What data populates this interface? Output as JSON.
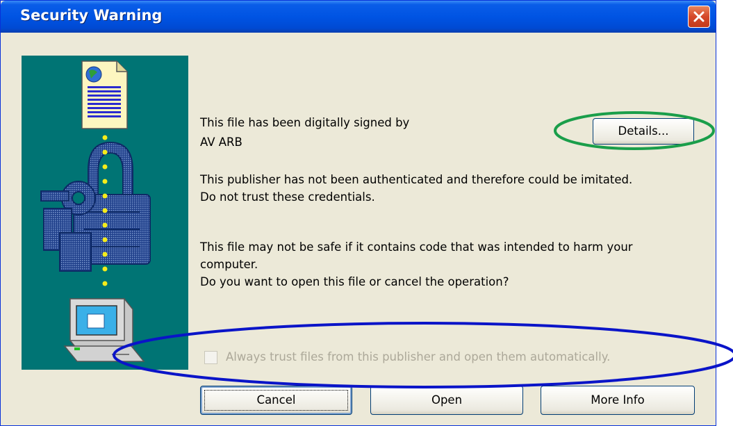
{
  "window": {
    "title": "Security Warning"
  },
  "message": {
    "signed_by_line": "This file has been digitally signed by",
    "publisher": "AV ARB",
    "auth_line1": "This publisher has not been authenticated and therefore could be imitated.",
    "auth_line2": "Do not trust these credentials.",
    "safety_line1": "This file may not be safe if it contains code that was intended to harm your",
    "safety_line2": "computer.",
    "safety_line3": "Do you want to open this file or cancel the operation?"
  },
  "details_button": {
    "label": "Details..."
  },
  "checkbox": {
    "label": "Always trust files from this publisher and open them automatically.",
    "checked": false,
    "enabled": false
  },
  "buttons": {
    "cancel": "Cancel",
    "open": "Open",
    "more_info": "More Info"
  },
  "colors": {
    "title_bar": "#0054e3",
    "dialog_bg": "#ece9d8",
    "art_panel_bg": "#007474",
    "annotation_green": "#1a9e4a",
    "annotation_blue": "#0a14c8"
  },
  "icons": {
    "close": "close-icon",
    "document": "certificate-document-icon",
    "padlock": "padlock-icon",
    "key": "key-icon",
    "computer": "computer-icon"
  }
}
